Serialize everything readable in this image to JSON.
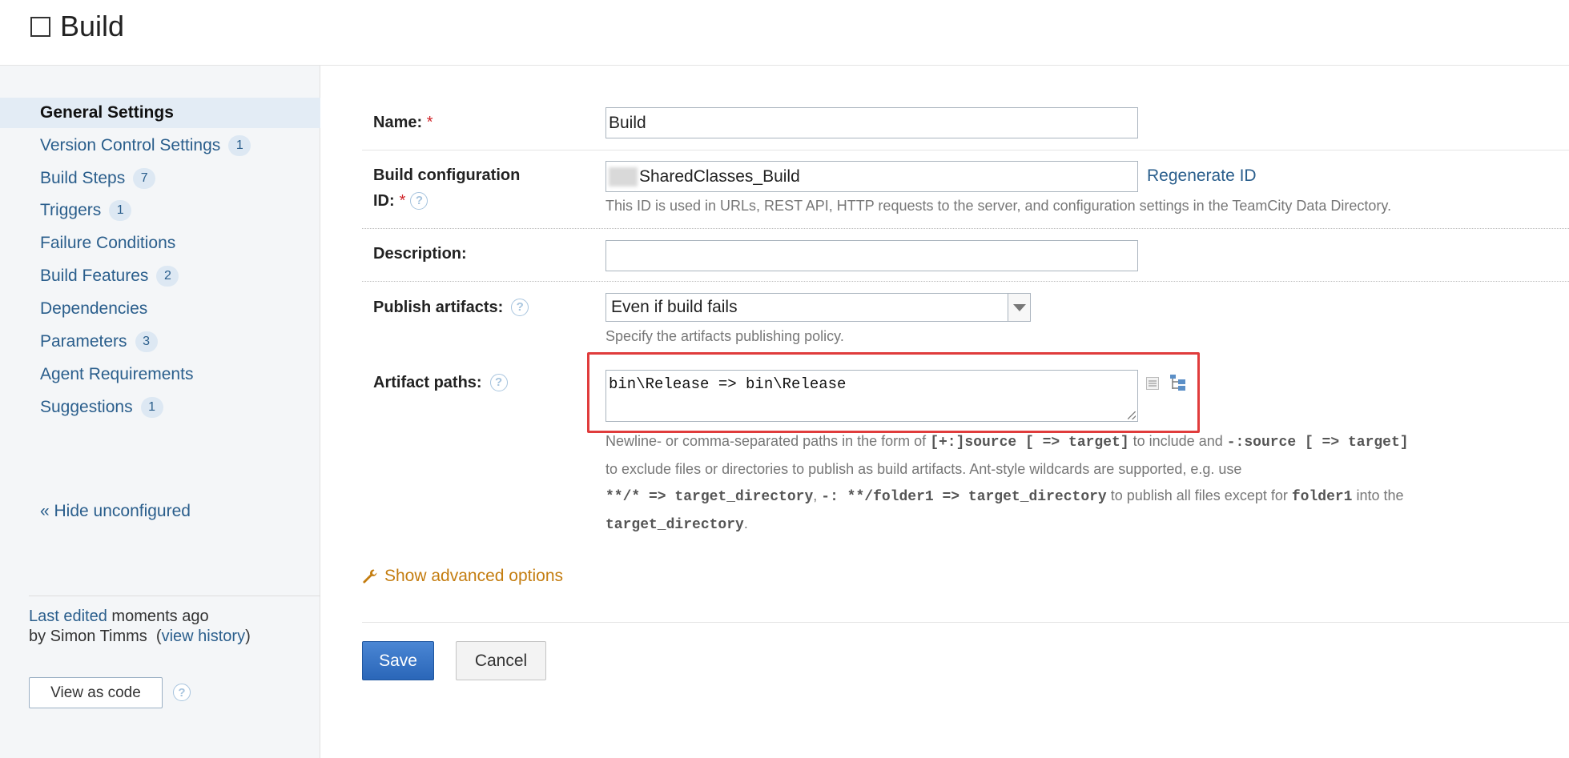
{
  "header": {
    "title": "Build"
  },
  "sidebar": {
    "items": [
      {
        "label": "General Settings",
        "count": ""
      },
      {
        "label": "Version Control Settings",
        "count": "1"
      },
      {
        "label": "Build Steps",
        "count": "7"
      },
      {
        "label": "Triggers",
        "count": "1"
      },
      {
        "label": "Failure Conditions",
        "count": ""
      },
      {
        "label": "Build Features",
        "count": "2"
      },
      {
        "label": "Dependencies",
        "count": ""
      },
      {
        "label": "Parameters",
        "count": "3"
      },
      {
        "label": "Agent Requirements",
        "count": ""
      },
      {
        "label": "Suggestions",
        "count": "1"
      }
    ],
    "hide_link": "« Hide unconfigured",
    "last_edited_link": "Last edited",
    "last_edited_time": " moments ago",
    "last_edited_by": "by Simon Timms",
    "view_history_link": "view history",
    "view_as_code": "View as code"
  },
  "form": {
    "name_label": "Name:",
    "name_value": "Build",
    "id_label_line1": "Build configuration",
    "id_label_line2": "ID:",
    "id_value": "SharedClasses_Build",
    "regenerate_id": "Regenerate ID",
    "id_hint": "This ID is used in URLs, REST API, HTTP requests to the server, and configuration settings in the TeamCity Data Directory.",
    "description_label": "Description:",
    "description_value": "",
    "publish_label": "Publish artifacts:",
    "publish_value": "Even if build fails",
    "publish_hint": "Specify the artifacts publishing policy.",
    "artifact_label": "Artifact paths:",
    "artifact_value": "bin\\Release => bin\\Release",
    "artifact_hint": {
      "p1": "Newline- or comma-separated paths in the form of ",
      "c1": "[+:]source [ => target]",
      "p2": " to include and ",
      "c2": "-:source [ => target]",
      "p3": "to exclude files or directories to publish as build artifacts. Ant-style wildcards are supported, e.g. use",
      "c3": "**/* => target_directory",
      "p4": ", ",
      "c4": "-: **/folder1 => target_directory",
      "p5": " to publish all files except for ",
      "c5": "folder1",
      "p6": " into the",
      "c6": "target_directory",
      "p7": "."
    },
    "required_mark": "*",
    "help_glyph": "?",
    "advanced_options": "Show advanced options",
    "save": "Save",
    "cancel": "Cancel"
  },
  "colors": {
    "link": "#2a5e8c",
    "required": "#d0252a",
    "highlight": "#e03c3c",
    "save_button": "#2a66b8",
    "advanced_link": "#c47d10"
  }
}
